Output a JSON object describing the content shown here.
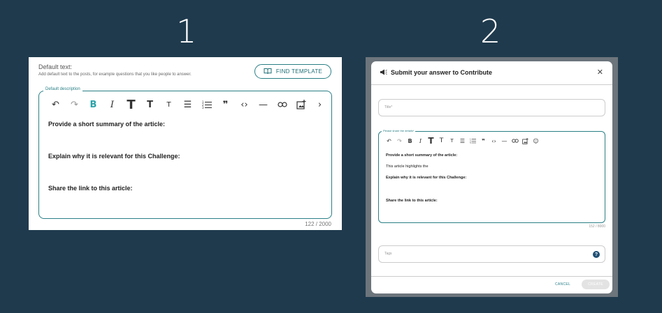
{
  "steps": {
    "one": "1",
    "two": "2"
  },
  "panel1": {
    "label": "Default text:",
    "helper": "Add default text to the posts, for example questions that you like people to answer.",
    "template_button": "FIND TEMPLATE",
    "editor_legend": "Default description",
    "lines": [
      "Provide a short summary of the article:",
      "Explain why it is relevant for this Challenge:",
      "Share the link to this article:"
    ],
    "counter": "122 / 2000"
  },
  "panel2": {
    "icon": "megaphone-icon",
    "title": "Submit your answer to Contribute",
    "close": "✕",
    "title_placeholder": "Title*",
    "editor_legend": "Please share the details*",
    "lines": [
      "Provide a short summary of the article:",
      "This article highlights the",
      "Explain why it is relevant for this Challenge:",
      "Share the link to this article:"
    ],
    "counter": "152 / 8000",
    "tags_placeholder": "Tags",
    "help": "?",
    "cancel": "CANCEL",
    "create": "CREATE"
  },
  "colors": {
    "background": "#1f3a4d",
    "accent": "#2a7f86",
    "bold_active": "#2aa3a8"
  }
}
